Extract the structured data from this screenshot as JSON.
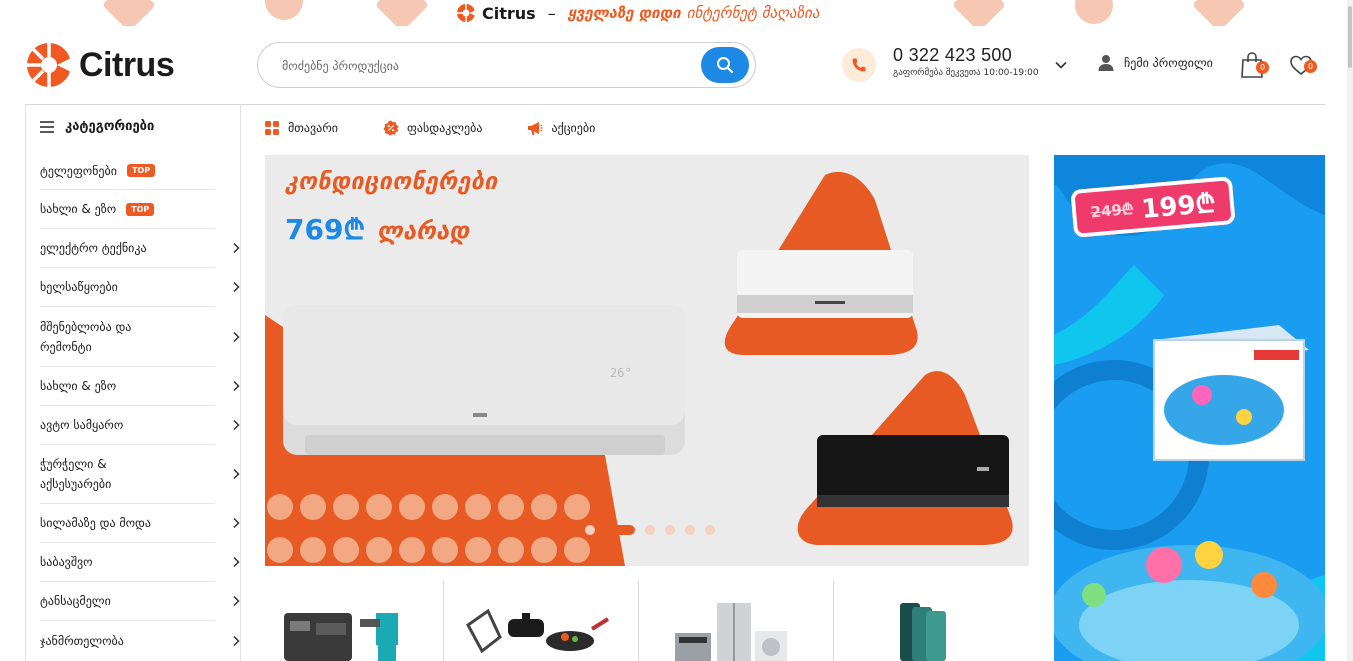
{
  "promo": {
    "brand": "Citrus",
    "dash": "–",
    "slogan_bold": "ყველაზე დიდი",
    "slogan_light": "ინტერნეტ მაღაზია"
  },
  "header": {
    "logo_text": "Citrus",
    "search_placeholder": "მოძებნე პროდუქცია",
    "phone_number": "0 322 423 500",
    "phone_hours": "გაფორმება შეკვეთა 10:00-19:00",
    "profile_label": "ჩემი პროფილი",
    "cart_count": "0",
    "wishlist_count": "0"
  },
  "sidebar": {
    "title": "კატეგორიები",
    "items": [
      {
        "label": "ტელეფონები",
        "badge": "TOP"
      },
      {
        "label": "სახლი & ეზო",
        "badge": "TOP"
      },
      {
        "label": "ელექტრო ტექნიკა"
      },
      {
        "label": "ხელსაწყოები"
      },
      {
        "label": "მშენებლობა და რემონტი"
      },
      {
        "label": "სახლი & ეზო"
      },
      {
        "label": "ავტო სამყარო"
      },
      {
        "label": "ჭურჭელი & აქსესუარები"
      },
      {
        "label": "სილამაზე და მოდა"
      },
      {
        "label": "საბავშვო"
      },
      {
        "label": "ტანსაცმელი"
      },
      {
        "label": "ჯანმრთელობა"
      }
    ]
  },
  "nav": {
    "items": [
      {
        "label": "მთავარი",
        "icon": "grid-icon"
      },
      {
        "label": "ფასდაკლება",
        "icon": "discount-icon"
      },
      {
        "label": "აქციები",
        "icon": "megaphone-icon"
      }
    ]
  },
  "banner": {
    "title": "კონდიციონერები",
    "price": "769₾",
    "price_suffix": "ლარად",
    "slide_count": 6,
    "active_slide": 2
  },
  "side_banner": {
    "old_price": "249₾",
    "new_price": "199₾"
  },
  "colors": {
    "accent": "#f05a22",
    "blue": "#1e88e5",
    "side_banner_bg": "#1a9cf0",
    "price_tag": "#ef3b6b"
  }
}
